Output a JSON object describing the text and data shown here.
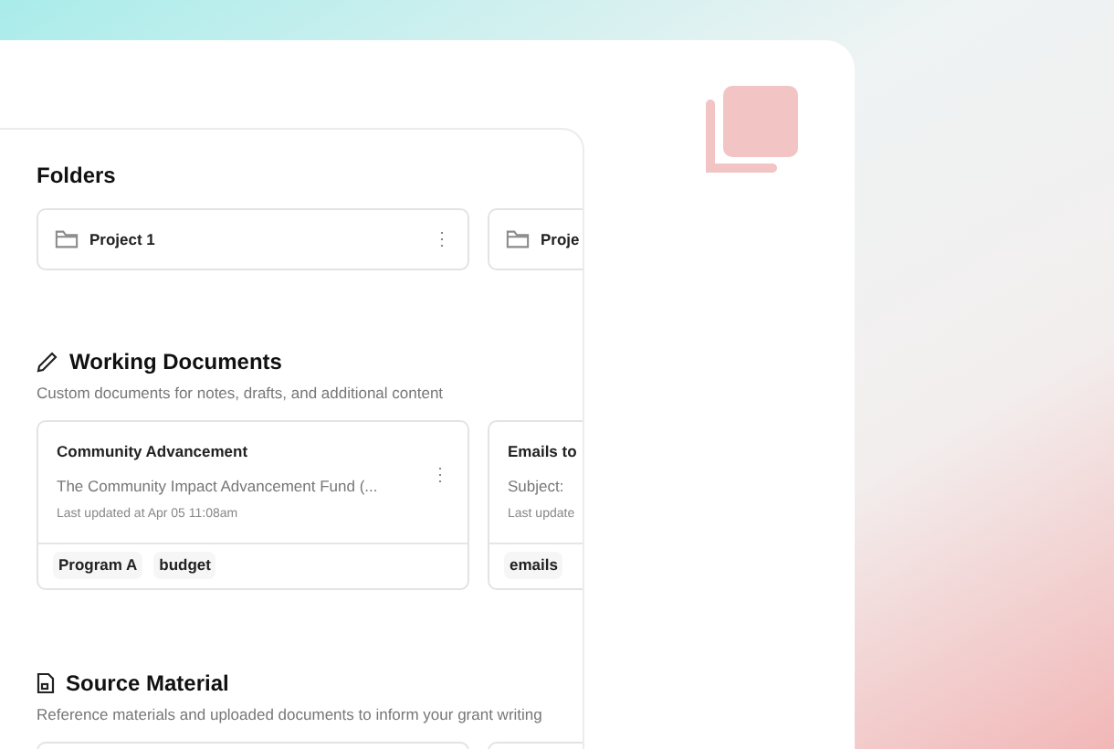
{
  "folders": {
    "title": "Folders",
    "items": [
      {
        "name": "Project 1",
        "menu": "⋮"
      },
      {
        "name": "Proje"
      }
    ]
  },
  "working_documents": {
    "title": "Working Documents",
    "subtitle": "Custom documents for notes, drafts, and additional content",
    "items": [
      {
        "title": "Community Advancement",
        "excerpt": "The Community Impact Advancement Fund (...",
        "updated": "Last updated at Apr 05 11:08am",
        "menu": "⋮",
        "tags": [
          "Program A",
          "budget"
        ]
      },
      {
        "title": "Emails to",
        "excerpt": "Subject:",
        "updated": "Last update",
        "tags": [
          "emails"
        ]
      }
    ]
  },
  "source_material": {
    "title": "Source Material",
    "subtitle": "Reference materials and uploaded documents to inform your grant writing"
  }
}
